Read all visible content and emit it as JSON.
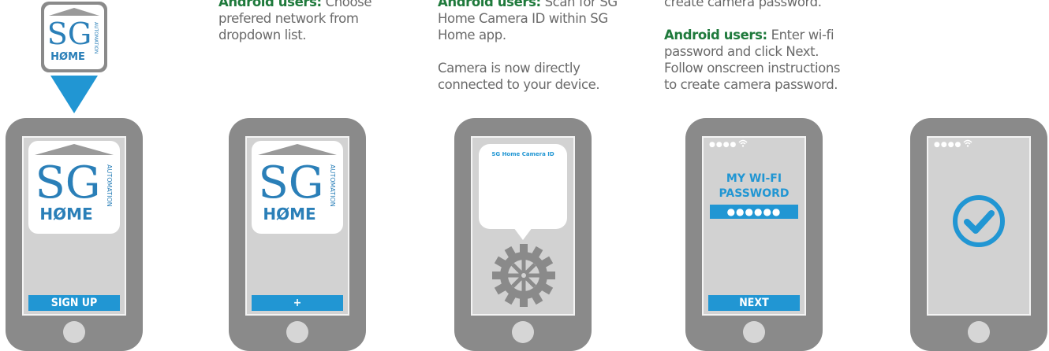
{
  "texts": {
    "col2_hl": "Android users:",
    "col2_line1_rest": " Choose",
    "col2_line2": "prefered network from",
    "col2_line3": "dropdown list.",
    "col3_hl": "Android users:",
    "col3_line1_rest": " Scan for SG",
    "col3_line2": "Home Camera ID within SG",
    "col3_line3": "Home app.",
    "col3_line4": "Camera is now directly",
    "col3_line5": "connected to your device.",
    "col4_line0": "create camera password.",
    "col4_hl": "Android users:",
    "col4_line1_rest": " Enter wi-fi",
    "col4_line2": "password and click Next.",
    "col4_line3": "Follow onscreen instructions",
    "col4_line4": "to create camera password."
  },
  "logo": {
    "sg": "SG",
    "home": "H",
    "home2": "ME",
    "automation": "AUTOMATION"
  },
  "phones": {
    "p1_button": "SIGN UP",
    "p2_button": "+",
    "p3_bubble": "SG Home Camera ID",
    "p4_title_line1": "MY WI-FI",
    "p4_title_line2": "PASSWORD",
    "p4_dots": "●●●●●●",
    "p4_button": "NEXT",
    "status": "●●●●"
  },
  "colors": {
    "accent": "#2196d3",
    "highlight": "#1f7a3c",
    "phone_body": "#8a8a8a",
    "screen": "#d2d2d2"
  }
}
